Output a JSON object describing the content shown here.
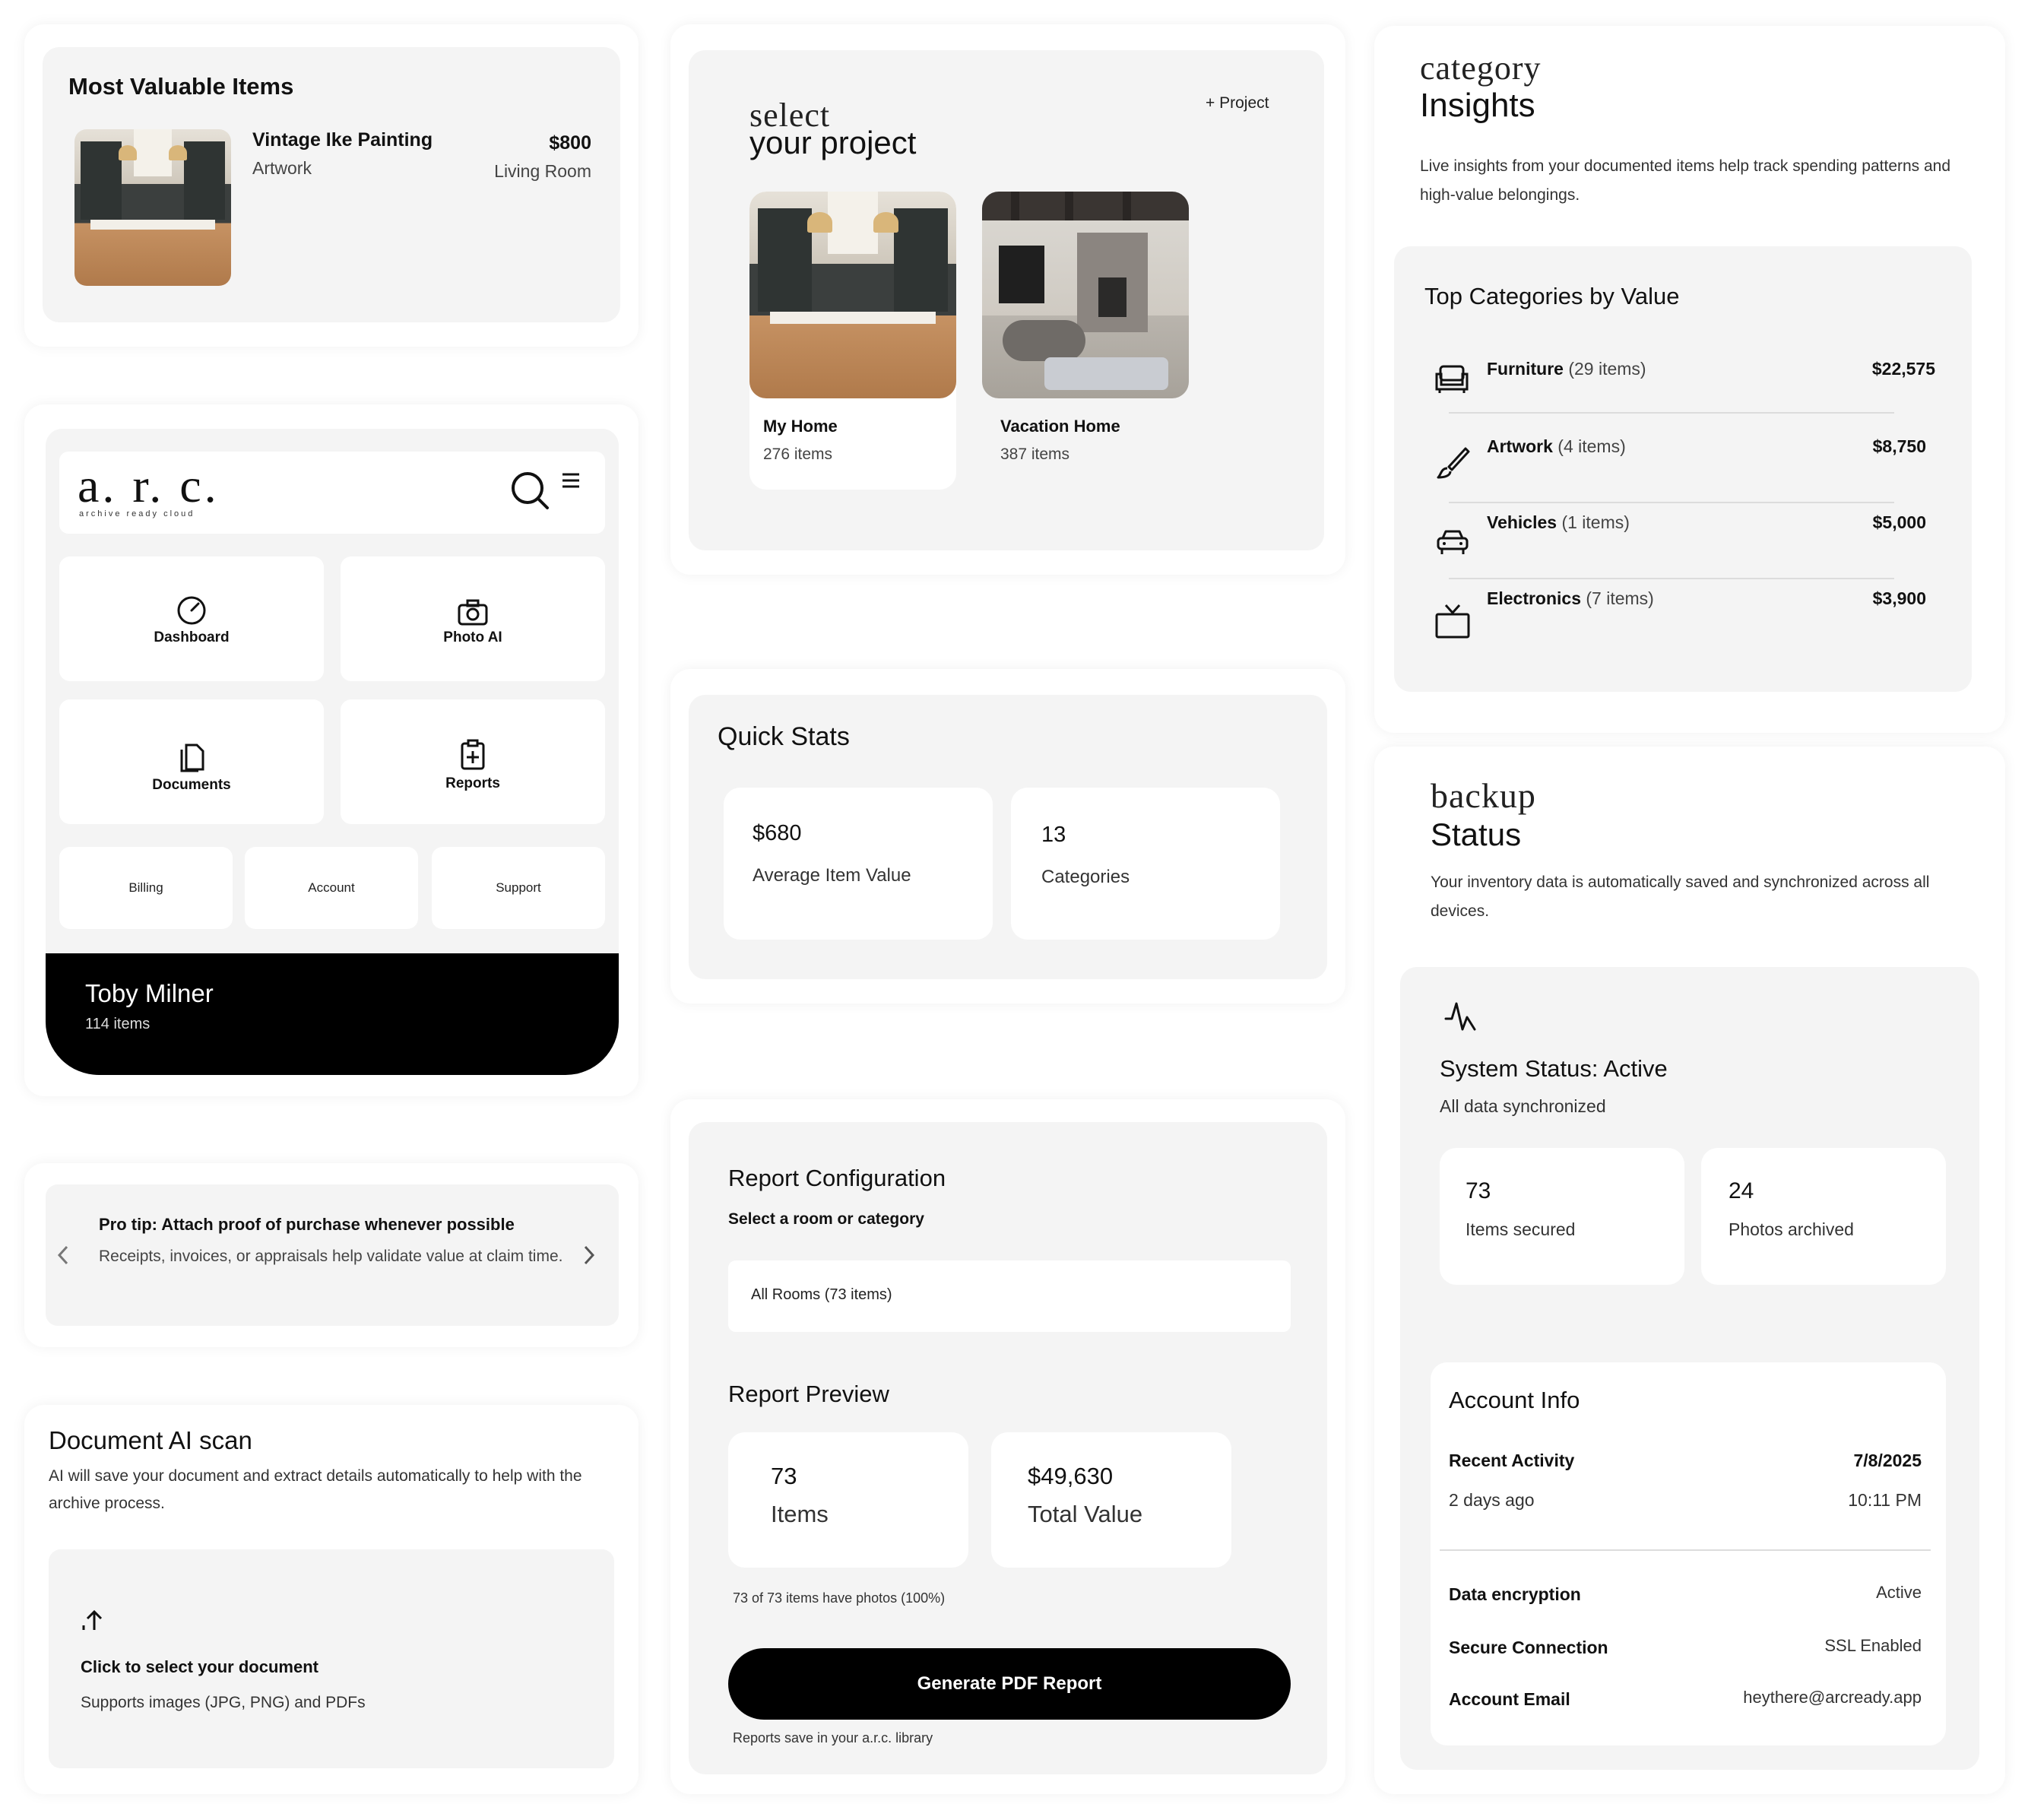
{
  "most_valuable": {
    "title": "Most Valuable Items",
    "item_name": "Vintage Ike Painting",
    "item_category": "Artwork",
    "item_value": "$800",
    "item_room": "Living Room"
  },
  "select_project": {
    "heading_light": "select",
    "heading_bold": "your project",
    "add_label": "+ Project",
    "projects": [
      {
        "name": "My Home",
        "count": "276 items"
      },
      {
        "name": "Vacation Home",
        "count": "387 items"
      }
    ]
  },
  "category_insights": {
    "heading_light": "category",
    "heading_bold": "Insights",
    "description": "Live insights from your documented items help track spending patterns and high-value belongings.",
    "card_title": "Top Categories by Value",
    "categories": [
      {
        "name": "Furniture",
        "count": " (29 items)",
        "value": "$22,575",
        "icon": "sofa-icon"
      },
      {
        "name": "Artwork",
        "count": " (4 items)",
        "value": "$8,750",
        "icon": "paintbrush-icon"
      },
      {
        "name": "Vehicles",
        "count": " (1 items)",
        "value": "$5,000",
        "icon": "car-icon"
      },
      {
        "name": "Electronics",
        "count": " (7 items)",
        "value": "$3,900",
        "icon": "tv-icon"
      }
    ]
  },
  "app_menu": {
    "logo": "a. r. c.",
    "logo_tagline": "archive ready cloud",
    "tiles": [
      {
        "label": "Dashboard",
        "icon": "gauge-icon"
      },
      {
        "label": "Photo AI",
        "icon": "camera-icon"
      },
      {
        "label": "Documents",
        "icon": "documents-icon"
      },
      {
        "label": "Reports",
        "icon": "report-icon"
      }
    ],
    "small_links": [
      "Billing",
      "Account",
      "Support"
    ],
    "user_name": "Toby Milner",
    "user_items": "114 items"
  },
  "quick_stats": {
    "title": "Quick Stats",
    "stats": [
      {
        "value": "$680",
        "label": "Average Item Value"
      },
      {
        "value": "13",
        "label": "Categories"
      }
    ]
  },
  "backup_status": {
    "heading_light": "backup",
    "heading_bold": "Status",
    "description": "Your inventory data is automatically saved and synchronized across all devices.",
    "system_status": "System Status: Active",
    "sync_text": "All data synchronized",
    "stats": [
      {
        "value": "73",
        "label": "Items secured"
      },
      {
        "value": "24",
        "label": "Photos archived"
      }
    ],
    "account_title": "Account Info",
    "recent_activity_label": "Recent Activity",
    "recent_activity_date": "7/8/2025",
    "recent_activity_ago": "2 days ago",
    "recent_activity_time": "10:11 PM",
    "rows": [
      {
        "label": "Data encryption",
        "value": "Active"
      },
      {
        "label": "Secure Connection",
        "value": "SSL Enabled"
      },
      {
        "label": "Account Email",
        "value": "heythere@arcready.app"
      }
    ]
  },
  "pro_tip": {
    "title": "Pro tip: Attach proof of purchase whenever possible",
    "body": "Receipts, invoices, or appraisals help validate value at claim time."
  },
  "report_config": {
    "title": "Report Configuration",
    "select_label": "Select a room or category",
    "select_value": "All Rooms (73 items)",
    "preview_title": "Report Preview",
    "preview_stats": [
      {
        "value": "73",
        "label": "Items"
      },
      {
        "value": "$49,630",
        "label": "Total Value"
      }
    ],
    "photo_note": "73 of 73 items have photos (100%)",
    "button_label": "Generate PDF Report",
    "footer_note": "Reports save in your a.r.c. library"
  },
  "doc_scan": {
    "title": "Document AI scan",
    "description": "AI will save your document and extract details automatically to help with the archive process.",
    "upload_title": "Click to select your document",
    "upload_sub": "Supports images (JPG, PNG) and PDFs"
  }
}
